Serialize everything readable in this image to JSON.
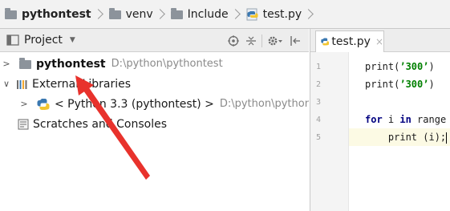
{
  "breadcrumb": {
    "items": [
      {
        "label": "pythontest",
        "icon": "folder-icon",
        "bold": true
      },
      {
        "label": "venv",
        "icon": "folder-icon",
        "bold": false
      },
      {
        "label": "Include",
        "icon": "folder-icon",
        "bold": false
      },
      {
        "label": "test.py",
        "icon": "python-file-icon",
        "bold": false
      }
    ]
  },
  "project_panel": {
    "title": "Project",
    "dropdown_icon": "chevron-down-icon",
    "toolbar_icons": [
      "sync-icon",
      "collapse-all-icon",
      "gear-icon",
      "hide-icon"
    ]
  },
  "tree": {
    "root": {
      "label": "pythontest",
      "path": "D:\\python\\pythontest",
      "icon": "folder-icon"
    },
    "external_libraries": {
      "label": "External Libraries",
      "icon": "library-icon"
    },
    "sdk": {
      "label": "< Python 3.3 (pythontest) >",
      "path": "D:\\python\\pythontest",
      "icon": "python-icon"
    },
    "scratches": {
      "label": "Scratches and Consoles",
      "icon": "scratches-icon"
    }
  },
  "editor": {
    "tab": {
      "label": "test.py",
      "icon": "python-file-icon",
      "close": "×"
    },
    "line_numbers": [
      "1",
      "2",
      "3",
      "4",
      "5"
    ],
    "lines": {
      "l1": {
        "fn": "print",
        "open": "(",
        "str": "’300’",
        "close": ")"
      },
      "l2": {
        "fn": "print",
        "open": "(",
        "str": "’300’",
        "close": ")"
      },
      "l4": {
        "kw1": "for",
        "var": " i ",
        "kw2": "in",
        "rest": " range"
      },
      "l5": {
        "text": "    print (i);"
      }
    }
  },
  "colors": {
    "annotation_arrow": "#e8322c",
    "keyword": "#000080",
    "string": "#008000",
    "current_line": "#fcfae4"
  }
}
